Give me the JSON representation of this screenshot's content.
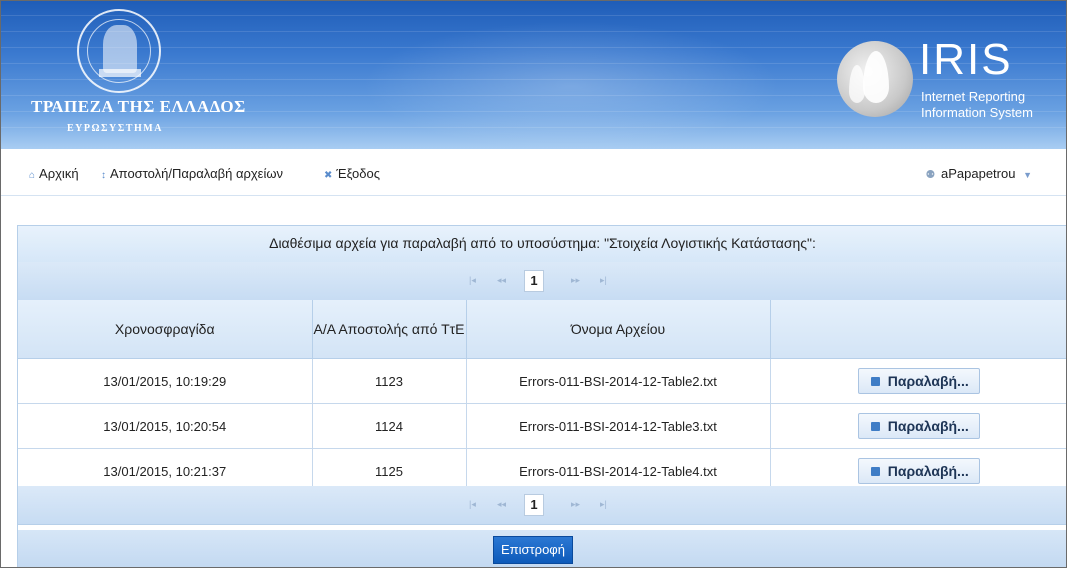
{
  "header": {
    "bank_name": "ΤΡΑΠΕΖΑ ΤΗΣ ΕΛΛΑΔΟΣ",
    "bank_subtitle": "ΕΥΡΩΣΥΣΤΗΜΑ",
    "app_title": "IRIS",
    "app_subtitle_line1": "Internet Reporting",
    "app_subtitle_line2": "Information System"
  },
  "nav": {
    "items": [
      {
        "label": "Αρχική",
        "icon": "home-icon"
      },
      {
        "label": "Αποστολή/Παραλαβή αρχείων",
        "icon": "updown-arrows-icon"
      },
      {
        "label": "Έξοδος",
        "icon": "close-icon"
      }
    ],
    "user": "aPapapetrou"
  },
  "panel": {
    "title": "Διαθέσιμα αρχεία για παραλαβή από το υποσύστημα: \"Στοιχεία Λογιστικής Κατάστασης\":",
    "pager": {
      "first": "|◂",
      "prev": "◂◂",
      "current_page": "1",
      "next": "▸▸",
      "last": "▸|"
    },
    "columns": [
      "Χρονοσφραγίδα",
      "Α/Α Αποστολής από ΤτΕ",
      "Όνομα Αρχείου",
      ""
    ],
    "rows": [
      {
        "timestamp": "13/01/2015, 10:19:29",
        "seq": "1123",
        "filename": "Errors-011-BSI-2014-12-Table2.txt",
        "action": "Παραλαβή..."
      },
      {
        "timestamp": "13/01/2015, 10:20:54",
        "seq": "1124",
        "filename": "Errors-011-BSI-2014-12-Table3.txt",
        "action": "Παραλαβή..."
      },
      {
        "timestamp": "13/01/2015, 10:21:37",
        "seq": "1125",
        "filename": "Errors-011-BSI-2014-12-Table4.txt",
        "action": "Παραλαβή..."
      }
    ],
    "back_button": "Επιστροφή"
  },
  "colors": {
    "banner_blue": "#1f5db8",
    "header_light_blue": "#d6e7f8",
    "primary_button": "#0d5aba"
  }
}
